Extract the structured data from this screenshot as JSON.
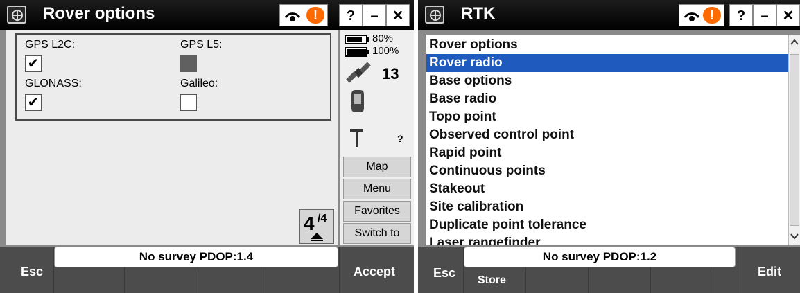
{
  "left": {
    "title": "Rover options",
    "alert_icon": "!",
    "window_buttons": {
      "help": "?",
      "minimize": "–",
      "close": "✕"
    },
    "fields": [
      {
        "label": "GPS L2C:",
        "checked": true,
        "enabled": true
      },
      {
        "label": "GPS L5:",
        "checked": false,
        "enabled": false
      },
      {
        "label": "GLONASS:",
        "checked": true,
        "enabled": true
      },
      {
        "label": "Galileo:",
        "checked": false,
        "enabled": true
      }
    ],
    "check_mark": "✔",
    "side": {
      "battery1": "80%",
      "battery2": "100%",
      "satellites": "13",
      "rod_status": "?",
      "buttons": [
        "Map",
        "Menu",
        "Favorites",
        "Switch to"
      ]
    },
    "page_indicator": {
      "current": "4",
      "total": "/4"
    },
    "status_text": "No survey  PDOP:1.4",
    "softkeys": {
      "left": "Esc",
      "right": "Accept"
    }
  },
  "right": {
    "title": "RTK",
    "alert_icon": "!",
    "window_buttons": {
      "help": "?",
      "minimize": "–",
      "close": "✕"
    },
    "list": [
      "Rover options",
      "Rover radio",
      "Base options",
      "Base radio",
      "Topo point",
      "Observed control point",
      "Rapid point",
      "Continuous points",
      "Stakeout",
      "Site calibration",
      "Duplicate point tolerance",
      "Laser rangefinder"
    ],
    "selected": "Rover radio",
    "status_text": "No survey  PDOP:1.2",
    "softkeys": {
      "left": "Esc",
      "store": "Store",
      "right": "Edit"
    }
  },
  "colors": {
    "titlebar": "#000000",
    "alert": "#ff6a00",
    "selection": "#1f5bbf",
    "softkey_bar": "#4c4c4c"
  },
  "icons": [
    "trimble-logo-icon",
    "wifi-icon",
    "alert-icon",
    "battery-icon",
    "satellite-icon",
    "receiver-icon",
    "rod-icon",
    "up-arrow-icon",
    "scroll-up-icon",
    "scroll-down-icon"
  ]
}
